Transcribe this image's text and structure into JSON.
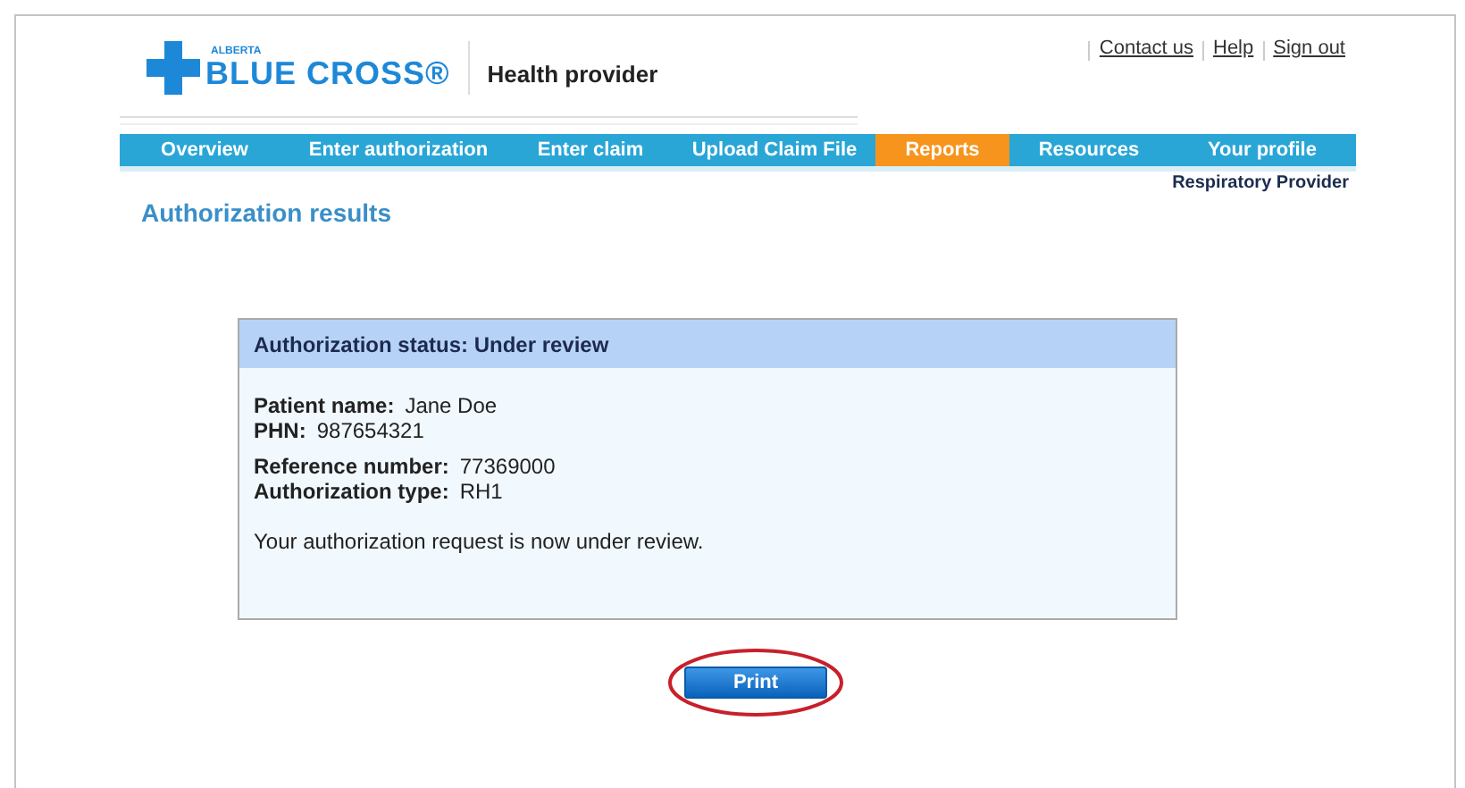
{
  "logo": {
    "region": "ALBERTA",
    "name": "BLUE CROSS®"
  },
  "site_title": "Health provider",
  "top_links": [
    "Contact us",
    "Help",
    "Sign out"
  ],
  "nav": [
    {
      "label": "Overview",
      "selected": false
    },
    {
      "label": "Enter authorization",
      "selected": false
    },
    {
      "label": "Enter claim",
      "selected": false
    },
    {
      "label": "Upload Claim File",
      "selected": false
    },
    {
      "label": "Reports",
      "selected": true
    },
    {
      "label": "Resources",
      "selected": false
    },
    {
      "label": "Your profile",
      "selected": false
    }
  ],
  "user_role": "Respiratory Provider",
  "page_title": "Authorization results",
  "panel": {
    "header": "Authorization status: Under review",
    "groups": [
      [
        {
          "label": "Patient name:",
          "value": "Jane Doe"
        },
        {
          "label": "PHN:",
          "value": "987654321"
        }
      ],
      [
        {
          "label": "Reference number:",
          "value": "77369000"
        },
        {
          "label": "Authorization type:",
          "value": "RH1"
        }
      ]
    ],
    "message": "Your authorization request is now under review."
  },
  "print_button": {
    "label": "Print",
    "highlighted": true
  }
}
